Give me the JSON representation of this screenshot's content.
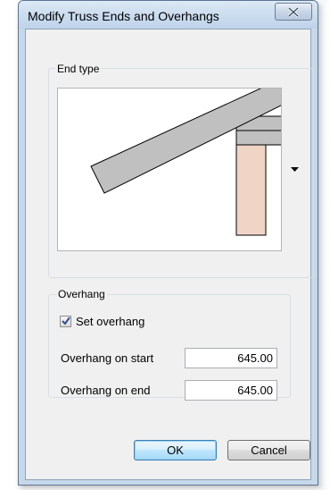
{
  "window": {
    "title": "Modify Truss Ends and Overhangs",
    "close_symbol": "X"
  },
  "end_type": {
    "label": "End type"
  },
  "overhang": {
    "label": "Overhang",
    "set_overhang_label": "Set overhang",
    "set_overhang_checked": true,
    "start_label": "Overhang on start",
    "start_value": "645.00",
    "end_label": "Overhang on end",
    "end_value": "645.00"
  },
  "buttons": {
    "ok": "OK",
    "cancel": "Cancel"
  },
  "icons": {
    "close": "close-icon",
    "check": "checkmark-icon",
    "dropdown": "dropdown-arrow-icon"
  },
  "colors": {
    "rafter": "#c0c0c0",
    "post": "#f0d5c7",
    "frame": "#c7d8ea"
  }
}
